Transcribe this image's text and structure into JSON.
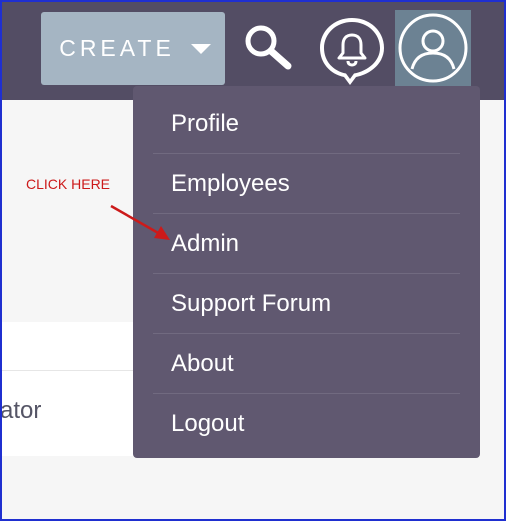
{
  "toolbar": {
    "create_label": "CREATE",
    "create_caret_icon": "caret-down-icon",
    "search_icon": "search-icon",
    "notifications_icon": "bell-icon",
    "user_icon": "user-avatar-icon"
  },
  "user_menu": {
    "items": [
      {
        "label": "Profile"
      },
      {
        "label": "Employees"
      },
      {
        "label": "Admin"
      },
      {
        "label": "Support Forum"
      },
      {
        "label": "About"
      },
      {
        "label": "Logout"
      }
    ]
  },
  "background": {
    "partial_text": "ator"
  },
  "annotation": {
    "text": "CLICK HERE",
    "color": "#cc1a1a"
  },
  "colors": {
    "topbar": "#534d64",
    "menu": "#605870",
    "create_button": "#a5b5c3",
    "avatar_button": "#6c8293",
    "frame": "#1f2fd0"
  }
}
